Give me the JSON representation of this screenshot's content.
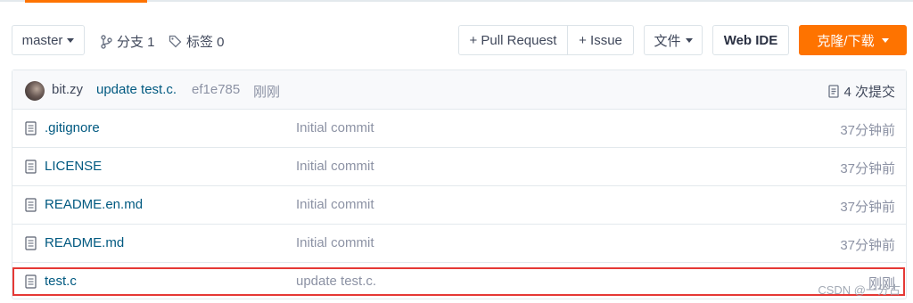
{
  "toolbar": {
    "branch": "master",
    "branches_label": "分支 1",
    "tags_label": "标签 0",
    "pull_request_label": "+ Pull Request",
    "issue_label": "+ Issue",
    "file_label": "文件",
    "web_ide_label": "Web IDE",
    "clone_label": "克隆/下载"
  },
  "latest_commit": {
    "author": "bit.zy",
    "message": "update test.c.",
    "sha": "ef1e785",
    "time": "刚刚",
    "commits_count": "4 次提交"
  },
  "files": [
    {
      "name": ".gitignore",
      "message": "Initial commit",
      "time": "37分钟前"
    },
    {
      "name": "LICENSE",
      "message": "Initial commit",
      "time": "37分钟前"
    },
    {
      "name": "README.en.md",
      "message": "Initial commit",
      "time": "37分钟前"
    },
    {
      "name": "README.md",
      "message": "Initial commit",
      "time": "37分钟前"
    },
    {
      "name": "test.c",
      "message": "update test.c.",
      "time": "刚刚"
    }
  ],
  "watermark": "CSDN @一分古",
  "colors": {
    "accent": "#fe7300",
    "link": "#005980",
    "highlight": "#e53935"
  }
}
